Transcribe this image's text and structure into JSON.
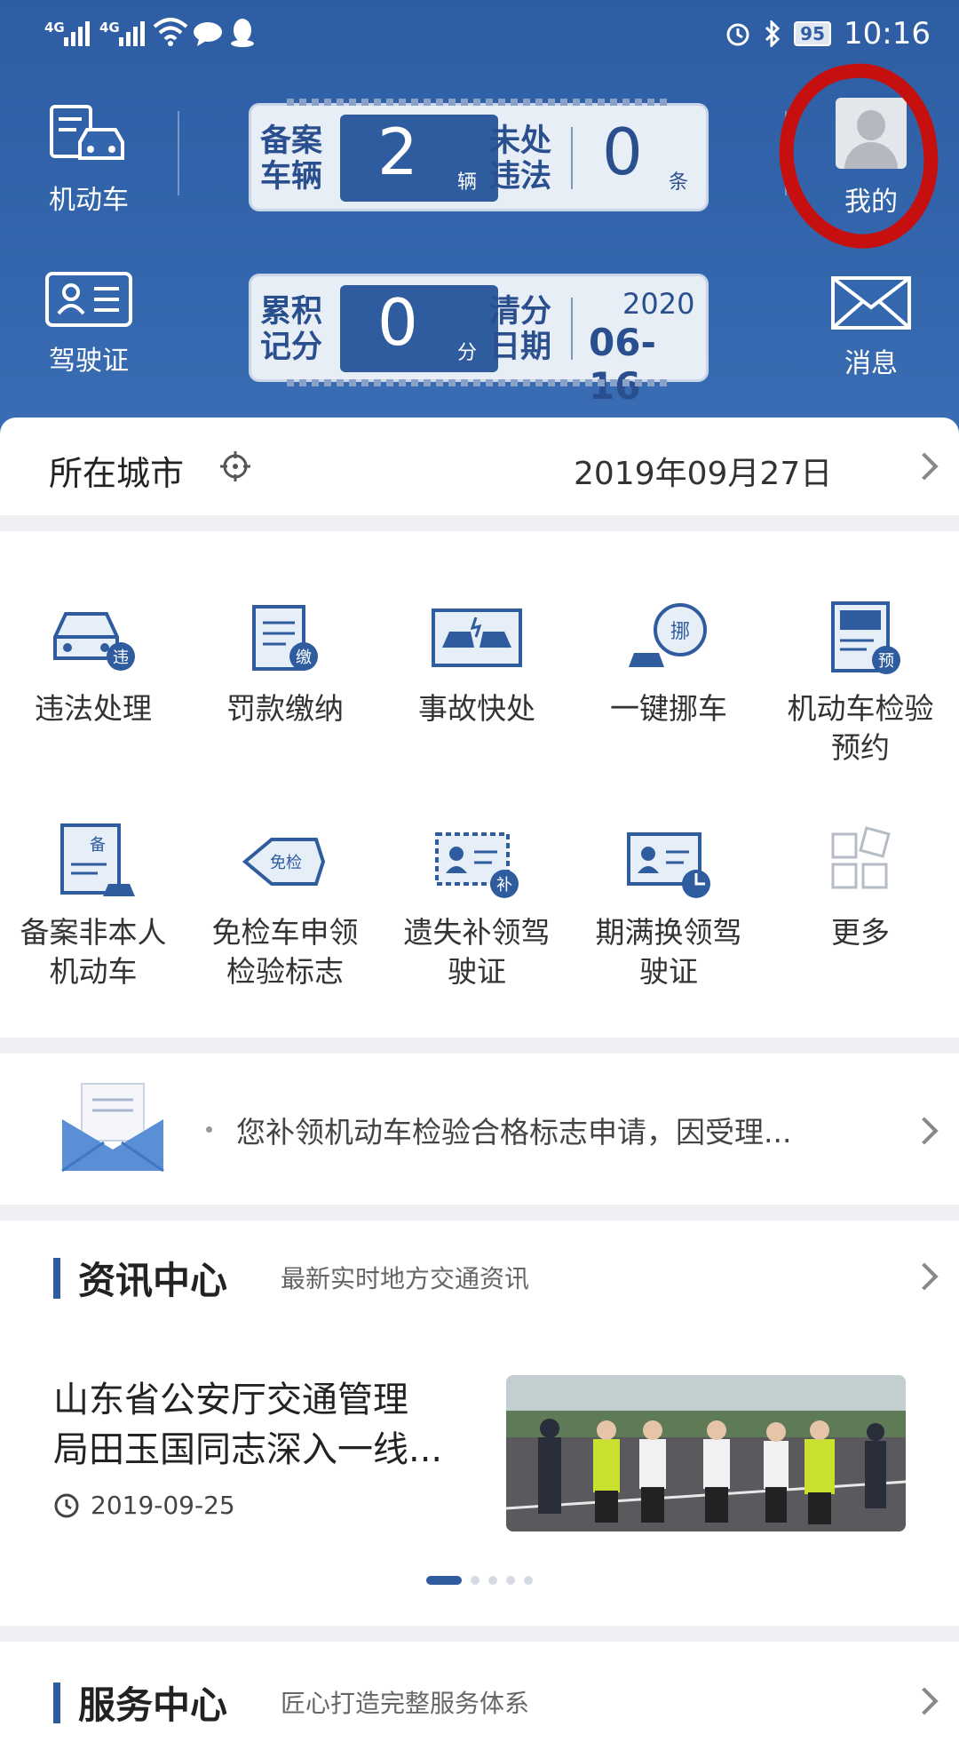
{
  "status_bar": {
    "sim1": "4G",
    "sim2": "4G",
    "battery": "95",
    "time": "10:16"
  },
  "header": {
    "left_top_label": "机动车",
    "left_bottom_label": "驾驶证",
    "right_top_label": "我的",
    "right_bottom_label": "消息",
    "vehicles": {
      "label_line1": "备案",
      "label_line2": "车辆",
      "value": "2",
      "unit": "辆"
    },
    "violations": {
      "label_line1": "未处",
      "label_line2": "违法",
      "value": "0",
      "unit": "条"
    },
    "points": {
      "label_line1": "累积",
      "label_line2": "记分",
      "value": "0",
      "unit": "分"
    },
    "clear_date": {
      "label_line1": "清分",
      "label_line2": "日期",
      "year": "2020",
      "date": "06-16"
    }
  },
  "city_row": {
    "label": "所在城市",
    "date": "2019年09月27日"
  },
  "services": [
    {
      "label": "违法处理",
      "badge": "违"
    },
    {
      "label": "罚款缴纳",
      "badge": "缴"
    },
    {
      "label": "事故快处",
      "badge": ""
    },
    {
      "label": "一键挪车",
      "badge": "挪"
    },
    {
      "label": "机动车检验预约",
      "badge": "预"
    },
    {
      "label": "备案非本人机动车",
      "badge": "备"
    },
    {
      "label": "免检车申领检验标志",
      "badge": "免检"
    },
    {
      "label": "遗失补领驾驶证",
      "badge": "补"
    },
    {
      "label": "期满换领驾驶证",
      "badge": ""
    },
    {
      "label": "更多",
      "badge": ""
    }
  ],
  "notice": {
    "text": "您补领机动车检验合格标志申请，因受理..."
  },
  "news_section": {
    "title": "资讯中心",
    "subtitle": "最新实时地方交通资讯",
    "headline_line1": "山东省公安厅交通管理",
    "headline_line2": "局田玉国同志深入一线...",
    "date": "2019-09-25"
  },
  "service_section": {
    "title": "服务中心",
    "subtitle": "匠心打造完整服务体系"
  },
  "colors": {
    "header_blue": "#3466ad",
    "icon_blue": "#2f5c9e",
    "highlight_red": "#c61010"
  }
}
